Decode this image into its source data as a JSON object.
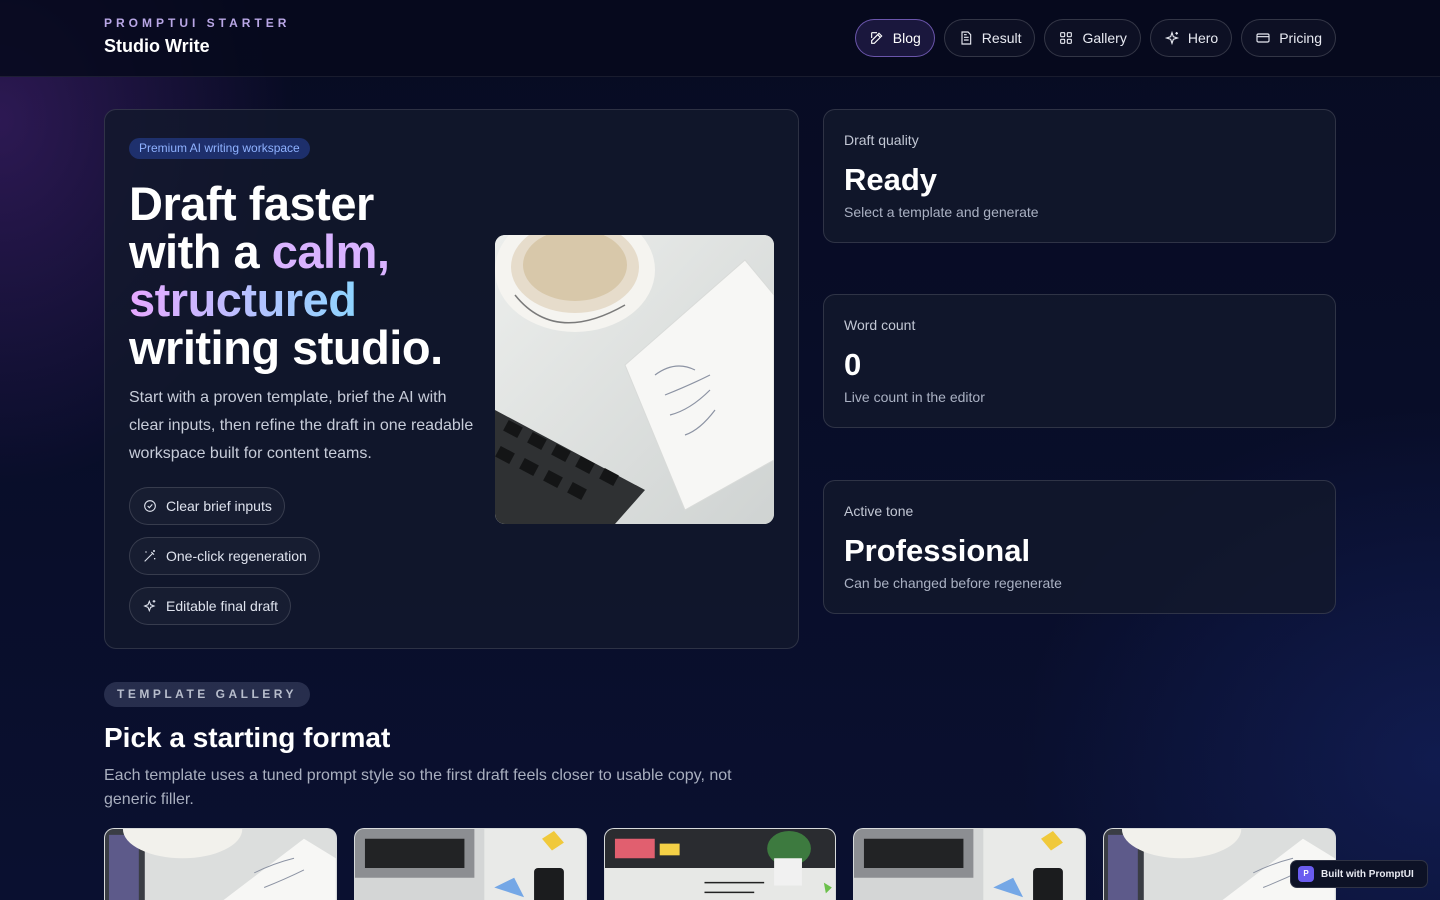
{
  "brand": {
    "kicker": "PROMPTUI STARTER",
    "name": "Studio Write"
  },
  "nav": {
    "items": [
      {
        "label": "Blog",
        "icon": "edit-icon",
        "active": true
      },
      {
        "label": "Result",
        "icon": "document-icon",
        "active": false
      },
      {
        "label": "Gallery",
        "icon": "grid-icon",
        "active": false
      },
      {
        "label": "Hero",
        "icon": "sparkles-icon",
        "active": false
      },
      {
        "label": "Pricing",
        "icon": "card-icon",
        "active": false
      }
    ]
  },
  "hero": {
    "badge": "Premium AI writing workspace",
    "title_line1": "Draft faster",
    "title_line2a": "with a ",
    "title_line2b": "calm,",
    "title_line3": "structured",
    "title_line4": "writing studio.",
    "description": "Start with a proven template, brief the AI with clear inputs, then refine the draft in one readable workspace built for content teams.",
    "features": [
      {
        "label": "Clear brief inputs",
        "icon": "check-circle-icon"
      },
      {
        "label": "One-click regeneration",
        "icon": "magic-wand-icon"
      },
      {
        "label": "Editable final draft",
        "icon": "sparkles-icon"
      }
    ]
  },
  "stats": [
    {
      "label": "Draft quality",
      "value": "Ready",
      "sub": "Select a template and generate"
    },
    {
      "label": "Word count",
      "value": "0",
      "sub": "Live count in the editor"
    },
    {
      "label": "Active tone",
      "value": "Professional",
      "sub": "Can be changed before regenerate"
    }
  ],
  "gallery": {
    "pill": "TEMPLATE GALLERY",
    "title": "Pick a starting format",
    "description": "Each template uses a tuned prompt style so the first draft feels closer to usable copy, not generic filler."
  },
  "footer_badge": {
    "logo": "P",
    "label": "Built with PromptUI"
  },
  "colors": {
    "background": "#060a1f",
    "accent": "#9b7bea",
    "badge_text": "#8fb2ff"
  }
}
